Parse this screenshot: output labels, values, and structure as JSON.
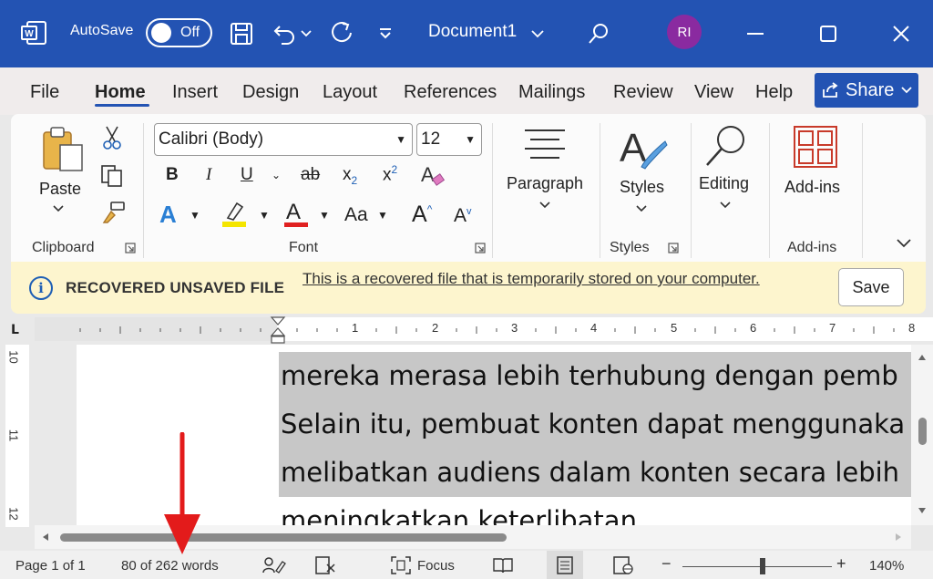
{
  "titlebar": {
    "autosave_label": "AutoSave",
    "autosave_state": "Off",
    "doc_title": "Document1",
    "user_initials": "RI",
    "accent_color": "#2353b3",
    "avatar_color": "#8a2aa0"
  },
  "menu": {
    "items": [
      "File",
      "Home",
      "Insert",
      "Design",
      "Layout",
      "References",
      "Mailings",
      "Review",
      "View",
      "Help"
    ],
    "active": "Home",
    "share_label": "Share"
  },
  "ribbon": {
    "clipboard": {
      "paste_label": "Paste",
      "group_label": "Clipboard"
    },
    "font": {
      "font_name": "Calibri (Body)",
      "font_size": "12",
      "group_label": "Font",
      "bold": "B",
      "italic": "I",
      "underline": "U",
      "strike": "ab",
      "subscript": "x",
      "superscript": "x",
      "change_case": "Aa",
      "grow": "A",
      "shrink": "A",
      "text_effects": "A",
      "font_color": "A"
    },
    "paragraph": {
      "label": "Paragraph"
    },
    "styles": {
      "label": "Styles",
      "group_label": "Styles"
    },
    "editing": {
      "label": "Editing"
    },
    "addins": {
      "label": "Add-ins",
      "group_label": "Add-ins"
    }
  },
  "infobar": {
    "title": "RECOVERED UNSAVED FILE",
    "message": "This is a recovered file that is temporarily stored on your computer.",
    "save_label": "Save"
  },
  "ruler": {
    "numbers": [
      "1",
      "2",
      "3",
      "4",
      "5",
      "6",
      "7",
      "8"
    ],
    "vertical_numbers": [
      "10",
      "11",
      "12"
    ]
  },
  "document": {
    "lines": [
      "mereka merasa lebih terhubung dengan pemb",
      "Selain itu, pembuat konten dapat menggunaka",
      "melibatkan audiens dalam konten secara lebih",
      "meningkatkan keterlibatan."
    ]
  },
  "statusbar": {
    "page": "Page 1 of 1",
    "words": "80 of 262 words",
    "focus_label": "Focus",
    "zoom": "140%",
    "zoom_minus": "−",
    "zoom_plus": "+"
  }
}
